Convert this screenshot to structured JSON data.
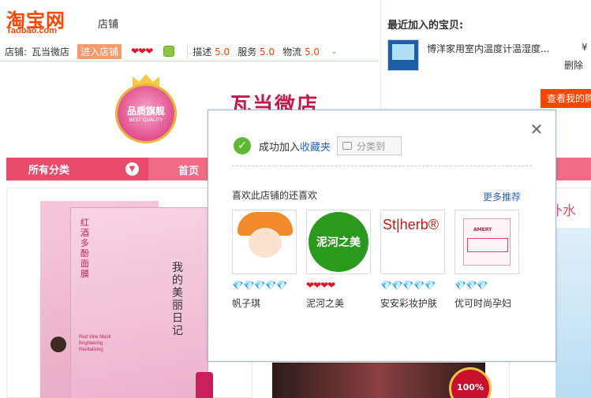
{
  "header": {
    "logo_cn": "淘宝网",
    "logo_en": "Taobao.com",
    "nav_store": "店铺"
  },
  "shopbar": {
    "store_label": "店铺:",
    "store_name": "瓦当微店",
    "enter_store": "进入店铺",
    "hearts": "❤❤❤",
    "ratings": [
      {
        "label": "描述",
        "value": "5.0"
      },
      {
        "label": "服务",
        "value": "5.0"
      },
      {
        "label": "物流",
        "value": "5.0"
      }
    ],
    "more_glyph": "⌄"
  },
  "banner": {
    "badge_text": "品质旗舰",
    "badge_sub": "BEST QUALITY",
    "shop_title": "瓦当微店"
  },
  "catbar": {
    "all_categories": "所有分类",
    "home": "首页"
  },
  "product1": {
    "vertical_text": "红酒多酚面膜",
    "diary_text": "我的美丽日记",
    "en_text": "Red Vine Mask\nBrightening\nRevitalising"
  },
  "product2": {
    "seal_text": "100%"
  },
  "product3": {
    "tag": "补水"
  },
  "recent_panel": {
    "title": "最近加入的宝贝:",
    "item_name": "博洋家用室内温度计温湿度...",
    "price_prefix": "¥",
    "delete": "删除",
    "cart_button": "查看我的购"
  },
  "popup": {
    "success_text": "成功加入",
    "success_link": "收藏夹",
    "classify_button": "分类到",
    "rec_title": "喜欢此店铺的还喜欢",
    "rec_more": "更多推荐",
    "close_glyph": "✕",
    "shops": [
      {
        "name": "帆子琪",
        "rank": "💎💎💎💎💎",
        "rank_type": "diamond"
      },
      {
        "name": "泥河之美",
        "rank": "❤❤❤❤",
        "rank_type": "heart",
        "logo_text": "泥河之美"
      },
      {
        "name": "安安彩妆护肤",
        "rank": "💎💎💎💎💎",
        "rank_type": "diamond",
        "logo_text": "St|herb®"
      },
      {
        "name": "优可时尚孕妇",
        "rank": "💎💎💎",
        "rank_type": "diamond",
        "logo_text": "AMERY"
      }
    ]
  },
  "colors": {
    "taobao_orange": "#ff4400",
    "category_bar": "#f06b86",
    "link_blue": "#2b65b5",
    "success_green": "#5db833"
  }
}
